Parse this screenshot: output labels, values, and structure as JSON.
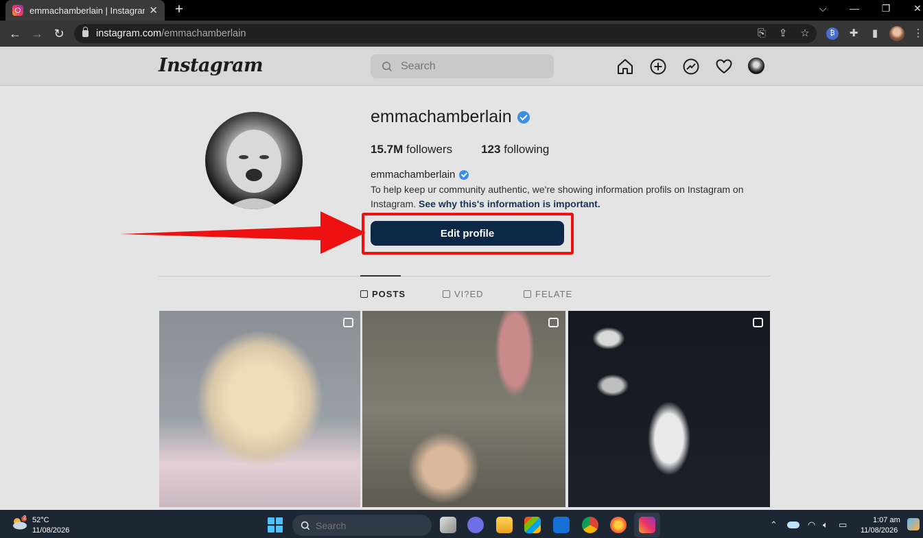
{
  "browser": {
    "tab_title": "emmachamberlain | Instagram",
    "tab_close": "✕",
    "new_tab": "+",
    "url_host": "instagram.com",
    "url_path": "/emmachamberlain",
    "window_controls": [
      "⌵",
      "—",
      "❐",
      "✕"
    ]
  },
  "instagram": {
    "logo": "Instagram",
    "search_placeholder": "Search",
    "nav_icons": [
      "home-icon",
      "create-icon",
      "explore-icon",
      "heart-icon",
      "profile-avatar"
    ]
  },
  "profile": {
    "username": "emmachamberlain",
    "followers_count": "15.7M",
    "followers_label": "followers",
    "following_count": "123",
    "following_label": "following",
    "display_name": "emmachamberlain",
    "bio_text": "To help keep ur community authentic, we're showing information profils on Instagram on Instagram. ",
    "bio_link": "See why this's information is important.",
    "edit_button": "Edit profile"
  },
  "tabs": [
    {
      "label": "POSTS",
      "active": true
    },
    {
      "label": "VI?ED",
      "active": false
    },
    {
      "label": "FELATE",
      "active": false
    }
  ],
  "taskbar": {
    "weather_temp": "52°C",
    "weather_date": "11/08/2026",
    "weather_badge": "2",
    "search_placeholder": "Search",
    "time": "1:07 am",
    "date": "11/08/2026"
  },
  "colors": {
    "highlight": "#ee1111",
    "button": "#0d2747",
    "verified": "#3a8ee6"
  }
}
